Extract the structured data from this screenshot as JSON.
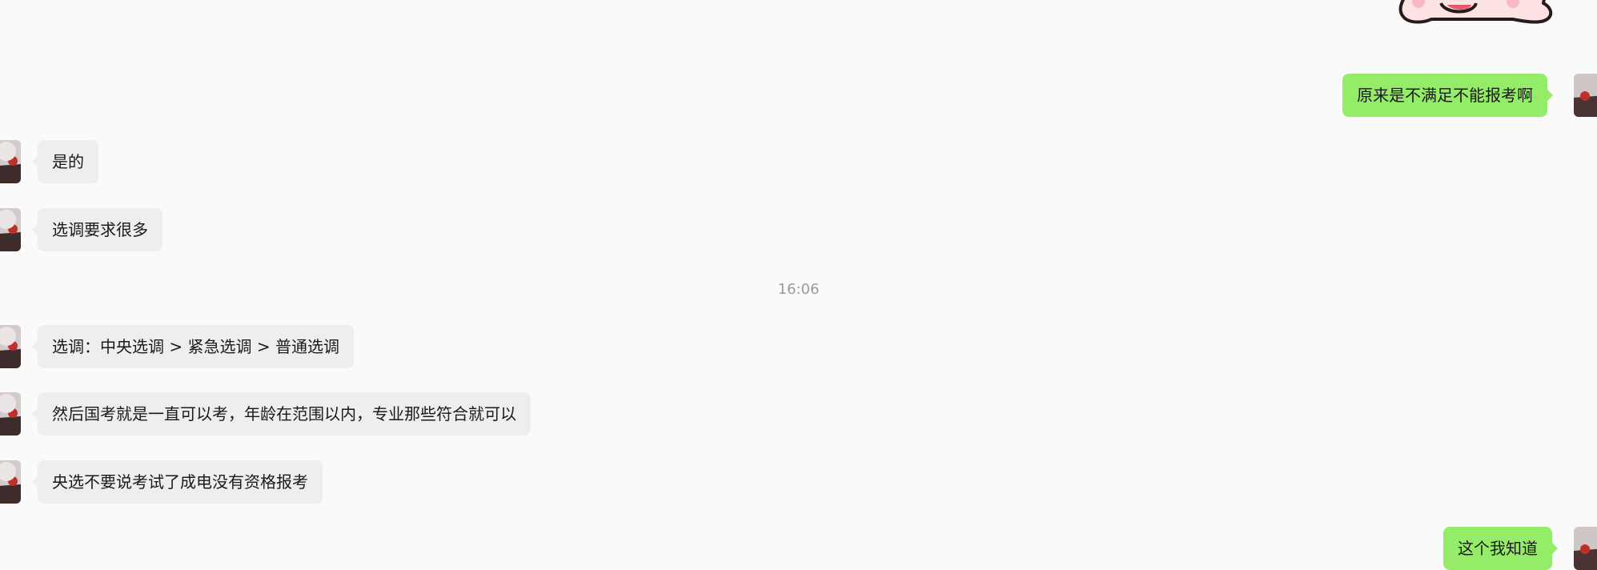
{
  "messages": [
    {
      "side": "right",
      "text": "原来是不满足不能报考啊"
    },
    {
      "side": "left",
      "text": "是的"
    },
    {
      "side": "left",
      "text": "选调要求很多"
    },
    {
      "side": "left",
      "text": "选调：中央选调 > 紧急选调 > 普通选调"
    },
    {
      "side": "left",
      "text": "然后国考就是一直可以考，年龄在范围以内，专业那些符合就可以"
    },
    {
      "side": "left",
      "text": "央选不要说考试了成电没有资格报考"
    },
    {
      "side": "right",
      "text": "这个我知道"
    }
  ],
  "timestamp": "16:06",
  "colors": {
    "self_bubble": "#95ec69",
    "other_bubble": "#eeeef0",
    "background": "#fafafa",
    "timestamp_text": "#9a9a9a"
  },
  "icons": {
    "sticker": "cartoon-pig-sticker",
    "avatar": "user-avatar"
  }
}
